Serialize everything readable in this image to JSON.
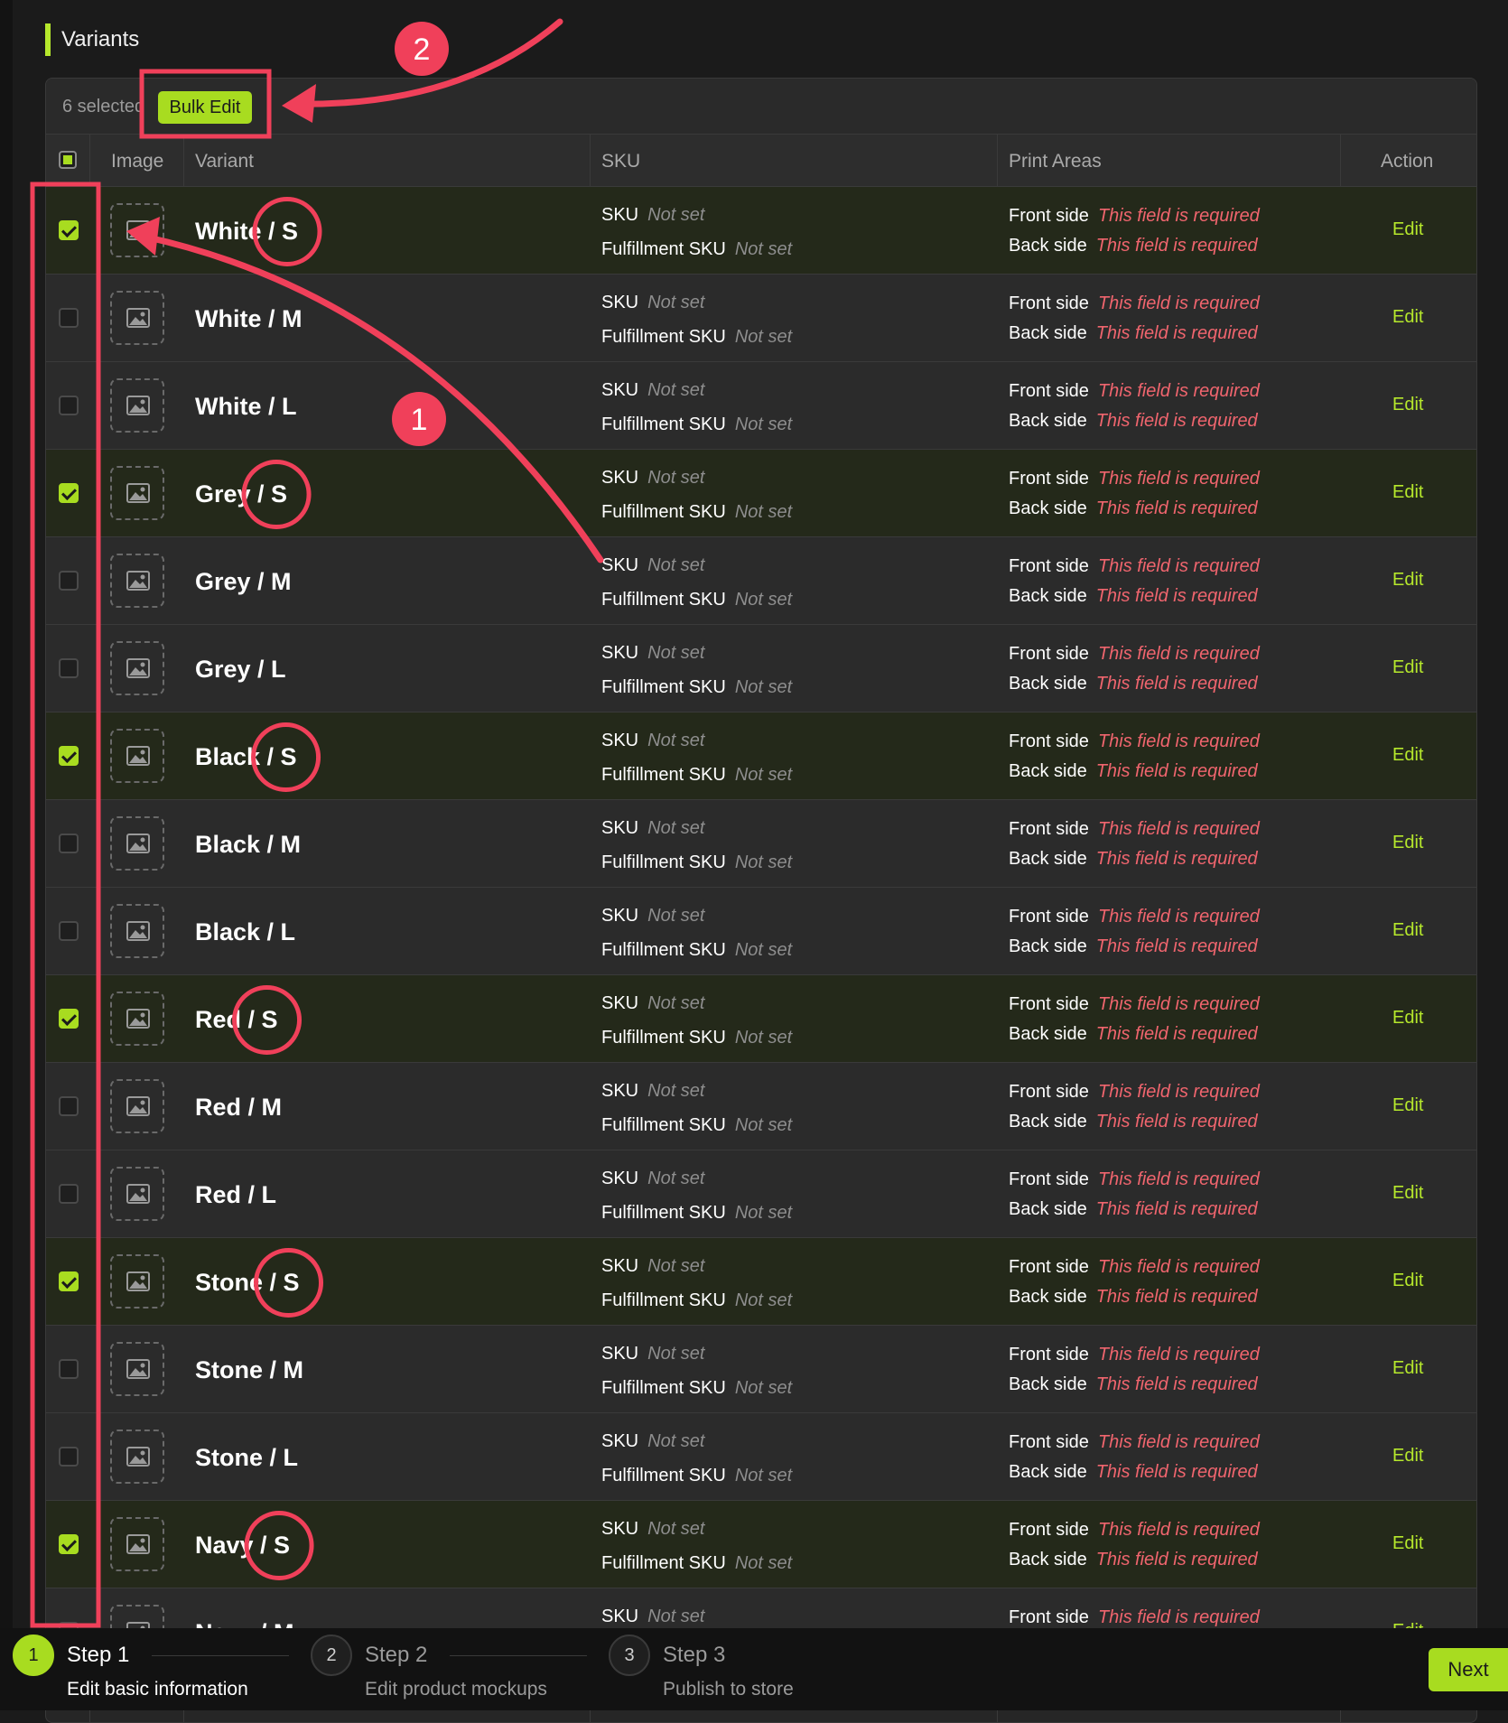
{
  "section": {
    "title": "Variants"
  },
  "bulk": {
    "selected_text": "6 selected",
    "bulk_edit_label": "Bulk Edit"
  },
  "columns": {
    "image": "Image",
    "variant": "Variant",
    "sku": "SKU",
    "print_areas": "Print Areas",
    "action": "Action"
  },
  "labels": {
    "sku": "SKU",
    "fulfillment_sku": "Fulfillment SKU",
    "not_set": "Not set",
    "front_side": "Front side",
    "back_side": "Back side",
    "required": "This field is required",
    "edit": "Edit"
  },
  "rows": [
    {
      "name": "White / S",
      "selected": true
    },
    {
      "name": "White / M",
      "selected": false
    },
    {
      "name": "White / L",
      "selected": false
    },
    {
      "name": "Grey / S",
      "selected": true
    },
    {
      "name": "Grey / M",
      "selected": false
    },
    {
      "name": "Grey / L",
      "selected": false
    },
    {
      "name": "Black / S",
      "selected": true
    },
    {
      "name": "Black / M",
      "selected": false
    },
    {
      "name": "Black / L",
      "selected": false
    },
    {
      "name": "Red / S",
      "selected": true
    },
    {
      "name": "Red / M",
      "selected": false
    },
    {
      "name": "Red / L",
      "selected": false
    },
    {
      "name": "Stone / S",
      "selected": true
    },
    {
      "name": "Stone / M",
      "selected": false
    },
    {
      "name": "Stone / L",
      "selected": false
    },
    {
      "name": "Navy / S",
      "selected": true
    },
    {
      "name": "Navy / M",
      "selected": false
    }
  ],
  "steps": [
    {
      "number": "1",
      "title": "Step 1",
      "subtitle": "Edit basic information",
      "active": true
    },
    {
      "number": "2",
      "title": "Step 2",
      "subtitle": "Edit product mockups",
      "active": false
    },
    {
      "number": "3",
      "title": "Step 3",
      "subtitle": "Publish to store",
      "active": false
    }
  ],
  "footer": {
    "next_label": "Next"
  },
  "annotations": {
    "badge_1": "1",
    "badge_2": "2"
  },
  "colors": {
    "accent": "#a8dc20",
    "annotation": "#f0405a",
    "error": "#f0656e",
    "selected_row": "#24291a"
  }
}
